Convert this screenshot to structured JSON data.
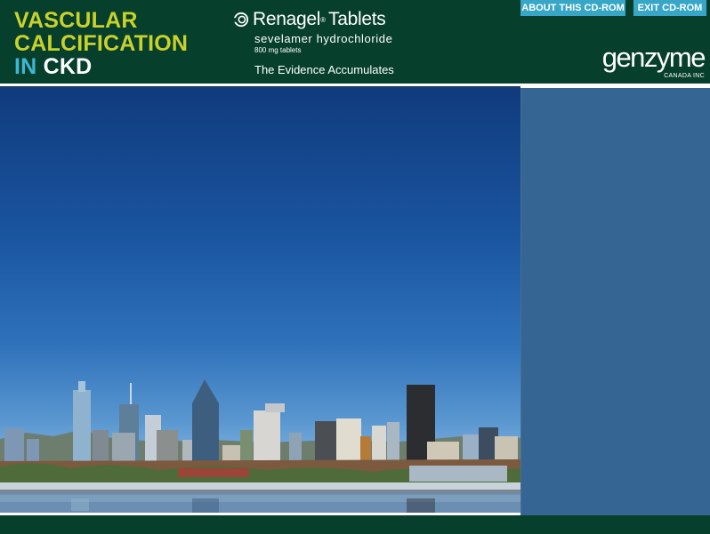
{
  "header": {
    "title_line1": "VASCULAR",
    "title_line2": "CALCIFICATION",
    "title_in": "IN",
    "title_ckd": "CKD",
    "brand_name": "Renagel",
    "brand_reg": "®",
    "brand_product": "Tablets",
    "generic_name": "sevelamer hydrochloride",
    "dose": "800 mg tablets",
    "tagline": "The Evidence Accumulates",
    "about_button": "ABOUT THIS CD-ROM",
    "exit_button": "EXIT CD-ROM",
    "company_logo": "genzyme",
    "company_sub": "CANADA INC"
  },
  "colors": {
    "header_bg": "#063f2c",
    "title_yellow": "#c9d22a",
    "title_blue": "#3fb7d4",
    "button_bg": "#38a7c7",
    "side_panel": "#356593"
  },
  "icons": {
    "brand_mark": "renagel-swirl-icon"
  }
}
